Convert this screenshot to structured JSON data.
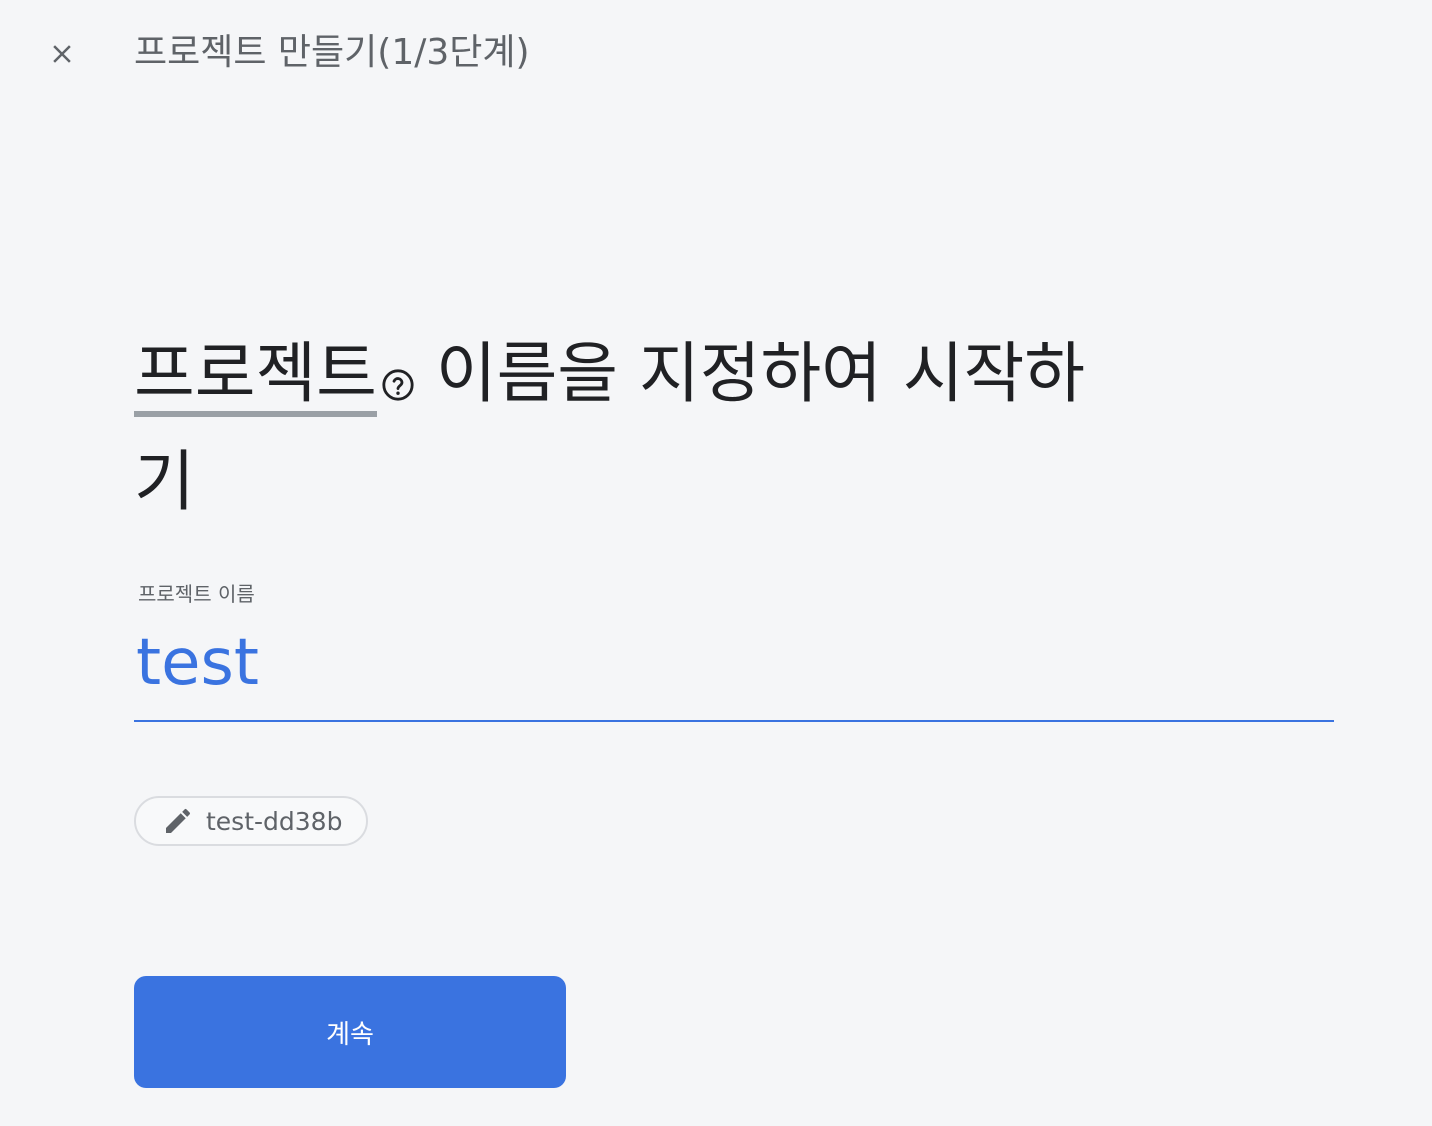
{
  "header": {
    "close_icon": "close-icon",
    "title": "프로젝트 만들기(1/3단계)"
  },
  "heading": {
    "term": "프로젝트",
    "help_icon": "help-circle-icon",
    "rest": " 이름을 지정하여 시작하기"
  },
  "project_name_field": {
    "label": "프로젝트 이름",
    "value": "test"
  },
  "project_id_chip": {
    "icon": "pencil-icon",
    "label": "test-dd38b"
  },
  "actions": {
    "continue_label": "계속"
  },
  "colors": {
    "accent": "#3a73e0",
    "background": "#f5f6f8",
    "text_primary": "#202124",
    "text_secondary": "#5f6368"
  }
}
